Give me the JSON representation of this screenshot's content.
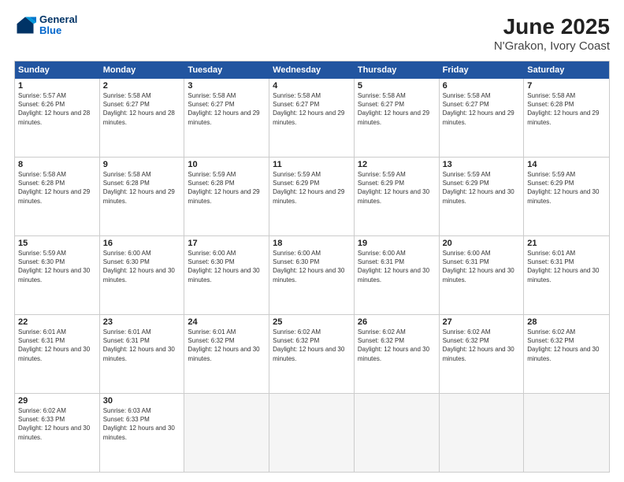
{
  "header": {
    "logo": {
      "line1": "General",
      "line2": "Blue"
    },
    "title": "June 2025",
    "subtitle": "N'Grakon, Ivory Coast"
  },
  "calendar": {
    "days": [
      "Sunday",
      "Monday",
      "Tuesday",
      "Wednesday",
      "Thursday",
      "Friday",
      "Saturday"
    ],
    "rows": [
      [
        {
          "day": "1",
          "sunrise": "5:57 AM",
          "sunset": "6:26 PM",
          "daylight": "12 hours and 28 minutes."
        },
        {
          "day": "2",
          "sunrise": "5:58 AM",
          "sunset": "6:27 PM",
          "daylight": "12 hours and 28 minutes."
        },
        {
          "day": "3",
          "sunrise": "5:58 AM",
          "sunset": "6:27 PM",
          "daylight": "12 hours and 29 minutes."
        },
        {
          "day": "4",
          "sunrise": "5:58 AM",
          "sunset": "6:27 PM",
          "daylight": "12 hours and 29 minutes."
        },
        {
          "day": "5",
          "sunrise": "5:58 AM",
          "sunset": "6:27 PM",
          "daylight": "12 hours and 29 minutes."
        },
        {
          "day": "6",
          "sunrise": "5:58 AM",
          "sunset": "6:27 PM",
          "daylight": "12 hours and 29 minutes."
        },
        {
          "day": "7",
          "sunrise": "5:58 AM",
          "sunset": "6:28 PM",
          "daylight": "12 hours and 29 minutes."
        }
      ],
      [
        {
          "day": "8",
          "sunrise": "5:58 AM",
          "sunset": "6:28 PM",
          "daylight": "12 hours and 29 minutes."
        },
        {
          "day": "9",
          "sunrise": "5:58 AM",
          "sunset": "6:28 PM",
          "daylight": "12 hours and 29 minutes."
        },
        {
          "day": "10",
          "sunrise": "5:59 AM",
          "sunset": "6:28 PM",
          "daylight": "12 hours and 29 minutes."
        },
        {
          "day": "11",
          "sunrise": "5:59 AM",
          "sunset": "6:29 PM",
          "daylight": "12 hours and 29 minutes."
        },
        {
          "day": "12",
          "sunrise": "5:59 AM",
          "sunset": "6:29 PM",
          "daylight": "12 hours and 30 minutes."
        },
        {
          "day": "13",
          "sunrise": "5:59 AM",
          "sunset": "6:29 PM",
          "daylight": "12 hours and 30 minutes."
        },
        {
          "day": "14",
          "sunrise": "5:59 AM",
          "sunset": "6:29 PM",
          "daylight": "12 hours and 30 minutes."
        }
      ],
      [
        {
          "day": "15",
          "sunrise": "5:59 AM",
          "sunset": "6:30 PM",
          "daylight": "12 hours and 30 minutes."
        },
        {
          "day": "16",
          "sunrise": "6:00 AM",
          "sunset": "6:30 PM",
          "daylight": "12 hours and 30 minutes."
        },
        {
          "day": "17",
          "sunrise": "6:00 AM",
          "sunset": "6:30 PM",
          "daylight": "12 hours and 30 minutes."
        },
        {
          "day": "18",
          "sunrise": "6:00 AM",
          "sunset": "6:30 PM",
          "daylight": "12 hours and 30 minutes."
        },
        {
          "day": "19",
          "sunrise": "6:00 AM",
          "sunset": "6:31 PM",
          "daylight": "12 hours and 30 minutes."
        },
        {
          "day": "20",
          "sunrise": "6:00 AM",
          "sunset": "6:31 PM",
          "daylight": "12 hours and 30 minutes."
        },
        {
          "day": "21",
          "sunrise": "6:01 AM",
          "sunset": "6:31 PM",
          "daylight": "12 hours and 30 minutes."
        }
      ],
      [
        {
          "day": "22",
          "sunrise": "6:01 AM",
          "sunset": "6:31 PM",
          "daylight": "12 hours and 30 minutes."
        },
        {
          "day": "23",
          "sunrise": "6:01 AM",
          "sunset": "6:31 PM",
          "daylight": "12 hours and 30 minutes."
        },
        {
          "day": "24",
          "sunrise": "6:01 AM",
          "sunset": "6:32 PM",
          "daylight": "12 hours and 30 minutes."
        },
        {
          "day": "25",
          "sunrise": "6:02 AM",
          "sunset": "6:32 PM",
          "daylight": "12 hours and 30 minutes."
        },
        {
          "day": "26",
          "sunrise": "6:02 AM",
          "sunset": "6:32 PM",
          "daylight": "12 hours and 30 minutes."
        },
        {
          "day": "27",
          "sunrise": "6:02 AM",
          "sunset": "6:32 PM",
          "daylight": "12 hours and 30 minutes."
        },
        {
          "day": "28",
          "sunrise": "6:02 AM",
          "sunset": "6:32 PM",
          "daylight": "12 hours and 30 minutes."
        }
      ],
      [
        {
          "day": "29",
          "sunrise": "6:02 AM",
          "sunset": "6:33 PM",
          "daylight": "12 hours and 30 minutes."
        },
        {
          "day": "30",
          "sunrise": "6:03 AM",
          "sunset": "6:33 PM",
          "daylight": "12 hours and 30 minutes."
        },
        null,
        null,
        null,
        null,
        null
      ]
    ]
  }
}
